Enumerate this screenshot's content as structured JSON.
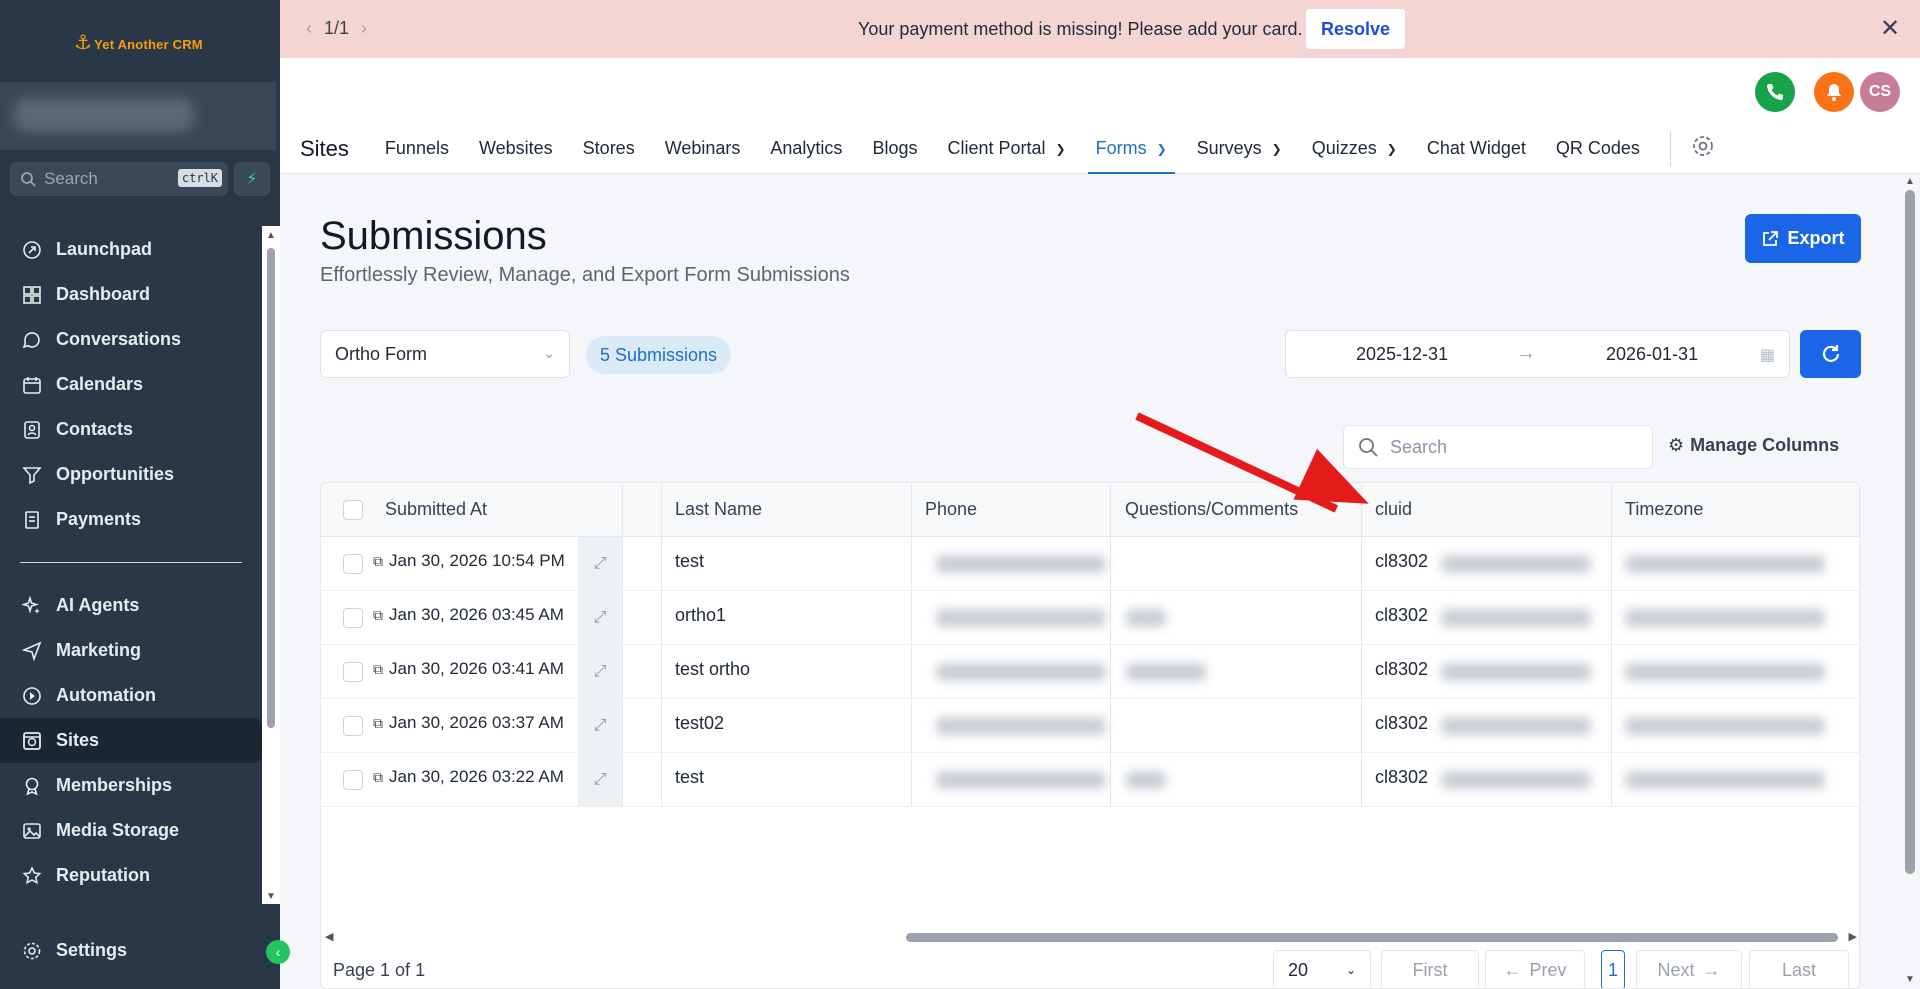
{
  "app": {
    "logo_text": "Yet Another CRM"
  },
  "sidebar": {
    "search_placeholder": "Search",
    "search_shortcut": "ctrlK",
    "items": [
      {
        "label": "Launchpad",
        "icon": "rocket-icon"
      },
      {
        "label": "Dashboard",
        "icon": "grid-icon"
      },
      {
        "label": "Conversations",
        "icon": "chat-icon"
      },
      {
        "label": "Calendars",
        "icon": "calendar-icon"
      },
      {
        "label": "Contacts",
        "icon": "contacts-icon"
      },
      {
        "label": "Opportunities",
        "icon": "filter-icon"
      },
      {
        "label": "Payments",
        "icon": "receipt-icon"
      }
    ],
    "items2": [
      {
        "label": "AI Agents",
        "icon": "sparkle-icon"
      },
      {
        "label": "Marketing",
        "icon": "send-icon"
      },
      {
        "label": "Automation",
        "icon": "automation-icon"
      },
      {
        "label": "Sites",
        "icon": "sites-icon",
        "active": true
      },
      {
        "label": "Memberships",
        "icon": "award-icon"
      },
      {
        "label": "Media Storage",
        "icon": "image-icon"
      },
      {
        "label": "Reputation",
        "icon": "star-icon"
      }
    ],
    "settings_label": "Settings"
  },
  "banner": {
    "pager": "1/1",
    "message": "Your payment method is missing! Please add your card.",
    "resolve_label": "Resolve"
  },
  "header": {
    "avatar_initials": "CS",
    "section_title": "Sites",
    "tabs": [
      {
        "label": "Funnels"
      },
      {
        "label": "Websites"
      },
      {
        "label": "Stores"
      },
      {
        "label": "Webinars"
      },
      {
        "label": "Analytics"
      },
      {
        "label": "Blogs"
      },
      {
        "label": "Client Portal",
        "dropdown": true
      },
      {
        "label": "Forms",
        "dropdown": true,
        "active": true
      },
      {
        "label": "Surveys",
        "dropdown": true
      },
      {
        "label": "Quizzes",
        "dropdown": true
      },
      {
        "label": "Chat Widget"
      },
      {
        "label": "QR Codes"
      }
    ]
  },
  "page": {
    "title": "Submissions",
    "subtitle": "Effortlessly Review, Manage, and Export Form Submissions",
    "export_label": "Export",
    "form_select": "Ortho Form",
    "submissions_badge": "5 Submissions",
    "date_from": "2025-12-31",
    "date_to": "2026-01-31",
    "table_search_placeholder": "Search",
    "manage_columns_label": "Manage Columns"
  },
  "table": {
    "columns": [
      "Submitted At",
      "Last Name",
      "Phone",
      "Questions/Comments",
      "cluid",
      "Timezone"
    ],
    "rows": [
      {
        "submitted_at": "Jan 30, 2026 10:54 PM",
        "last_name": "test",
        "cluid": "cl8302"
      },
      {
        "submitted_at": "Jan 30, 2026 03:45 AM",
        "last_name": "ortho1",
        "cluid": "cl8302"
      },
      {
        "submitted_at": "Jan 30, 2026 03:41 AM",
        "last_name": "test ortho",
        "cluid": "cl8302"
      },
      {
        "submitted_at": "Jan 30, 2026 03:37 AM",
        "last_name": "test02",
        "cluid": "cl8302"
      },
      {
        "submitted_at": "Jan 30, 2026 03:22 AM",
        "last_name": "test",
        "cluid": "cl8302"
      }
    ]
  },
  "pagination": {
    "page_label": "Page 1 of 1",
    "page_size": "20",
    "first": "First",
    "prev": "Prev",
    "current": "1",
    "next": "Next",
    "last": "Last"
  },
  "colors": {
    "accent": "#1a66e6",
    "sidebar": "#2a3747",
    "banner": "#f5d5d3",
    "annotation_arrow": "#e51b1b"
  }
}
